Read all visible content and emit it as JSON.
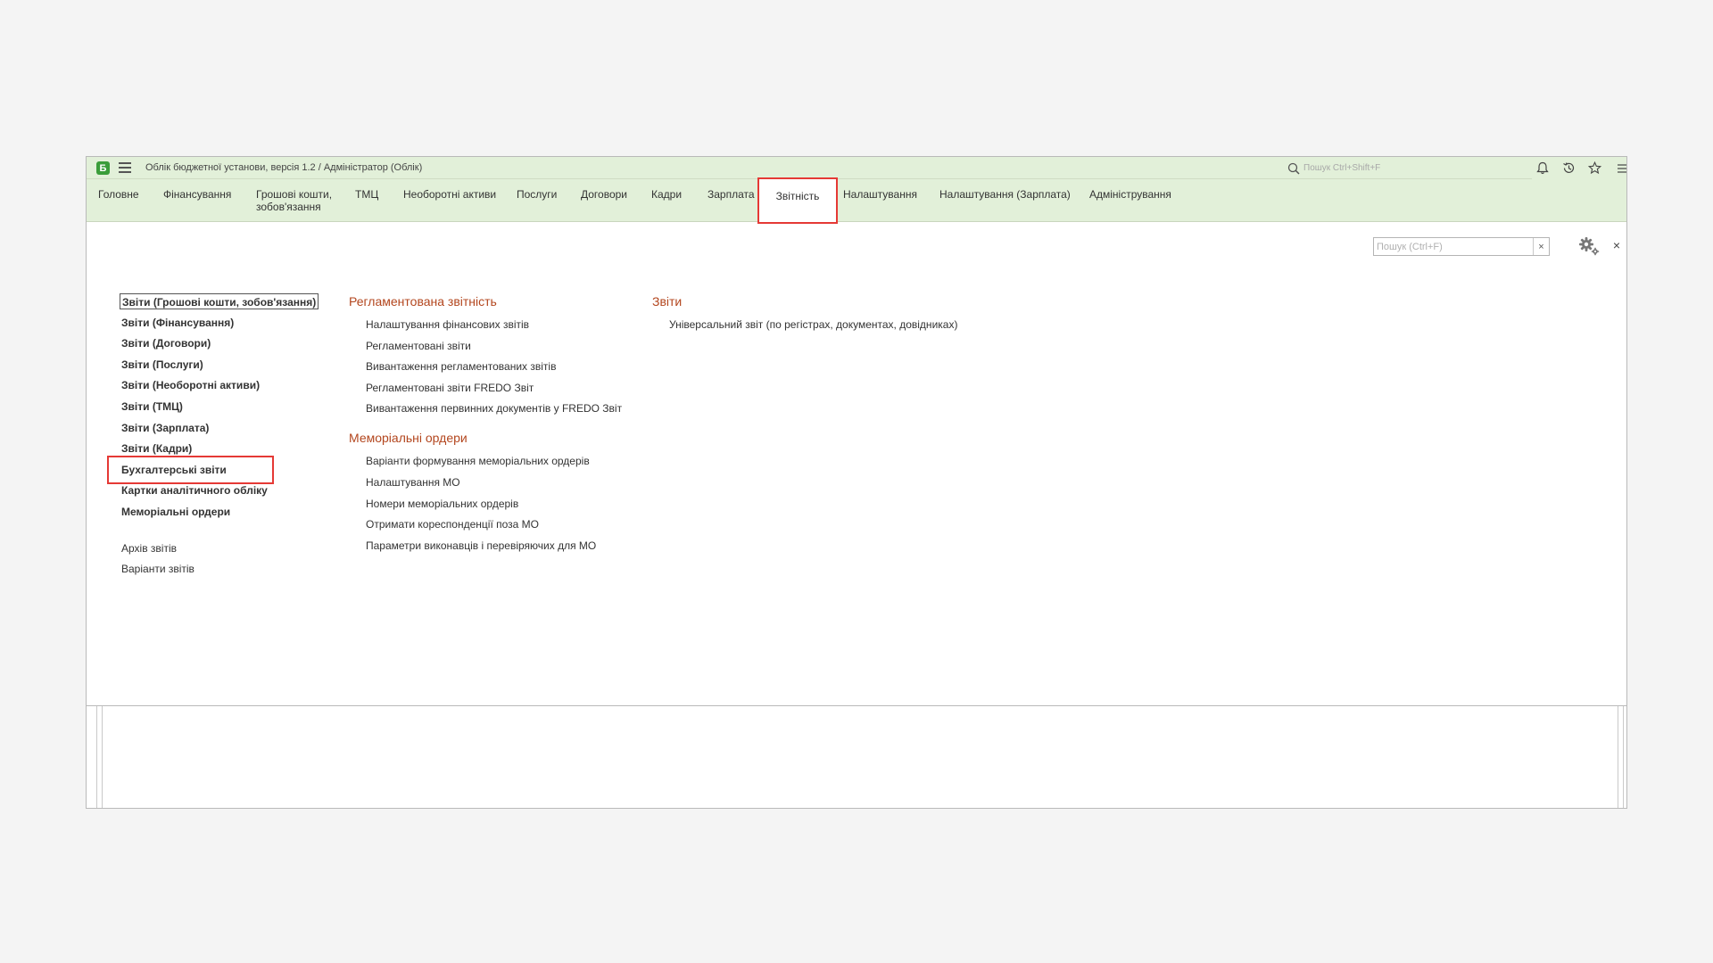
{
  "titlebar": {
    "logo_text": "Б",
    "title": "Облік бюджетної установи, версія 1.2 / Адміністратор  (Облік)",
    "search_placeholder": "Пошук Ctrl+Shift+F",
    "icons": [
      "bell-icon",
      "history-icon",
      "star-icon",
      "more-icon"
    ]
  },
  "sections": [
    {
      "label": "Головне"
    },
    {
      "label": "Фінансування"
    },
    {
      "label": "Грошові кошти, зобов'язання"
    },
    {
      "label": "ТМЦ"
    },
    {
      "label": "Необоротні активи"
    },
    {
      "label": "Послуги"
    },
    {
      "label": "Договори"
    },
    {
      "label": "Кадри"
    },
    {
      "label": "Зарплата"
    },
    {
      "label": "Звітність",
      "active": true
    },
    {
      "label": "Налаштування"
    },
    {
      "label": "Налаштування (Зарплата)"
    },
    {
      "label": "Адміністрування"
    }
  ],
  "form_search": {
    "placeholder": "Пошук (Ctrl+F)",
    "clear_label": "×"
  },
  "close_label": "×",
  "left_links": {
    "bold": [
      "Звіти (Грошові кошти, зобов'язання)",
      "Звіти (Фінансування)",
      "Звіти (Договори)",
      "Звіти (Послуги)",
      "Звіти (Необоротні активи)",
      "Звіти (ТМЦ)",
      "Звіти (Зарплата)",
      "Звіти (Кадри)",
      "Бухгалтерські звіти",
      "Картки аналітичного обліку",
      "Меморіальні ордери"
    ],
    "normal": [
      "Архів звітів",
      "Варіанти звітів"
    ]
  },
  "groups": {
    "reglament": {
      "title": "Регламентована звітність",
      "items": [
        "Налаштування фінансових звітів",
        "Регламентовані звіти",
        "Вивантаження регламентованих звітів",
        "Регламентовані звіти FREDO Звіт",
        "Вивантаження первинних документів у FREDO Звіт"
      ]
    },
    "memorial": {
      "title": "Меморіальні ордери",
      "items": [
        "Варіанти формування меморіальних ордерів",
        "Налаштування МО",
        "Номери меморіальних ордерів",
        "Отримати кореспонденції поза МО",
        "Параметри виконавців і перевіряючих для МО"
      ]
    },
    "reports": {
      "title": "Звіти",
      "items": [
        "Універсальний звіт (по регістрах, документах, довідниках)"
      ]
    }
  },
  "colors": {
    "header_bg": "#e2f0d9",
    "group_title": "#b3461e",
    "highlight": "#e53935"
  }
}
